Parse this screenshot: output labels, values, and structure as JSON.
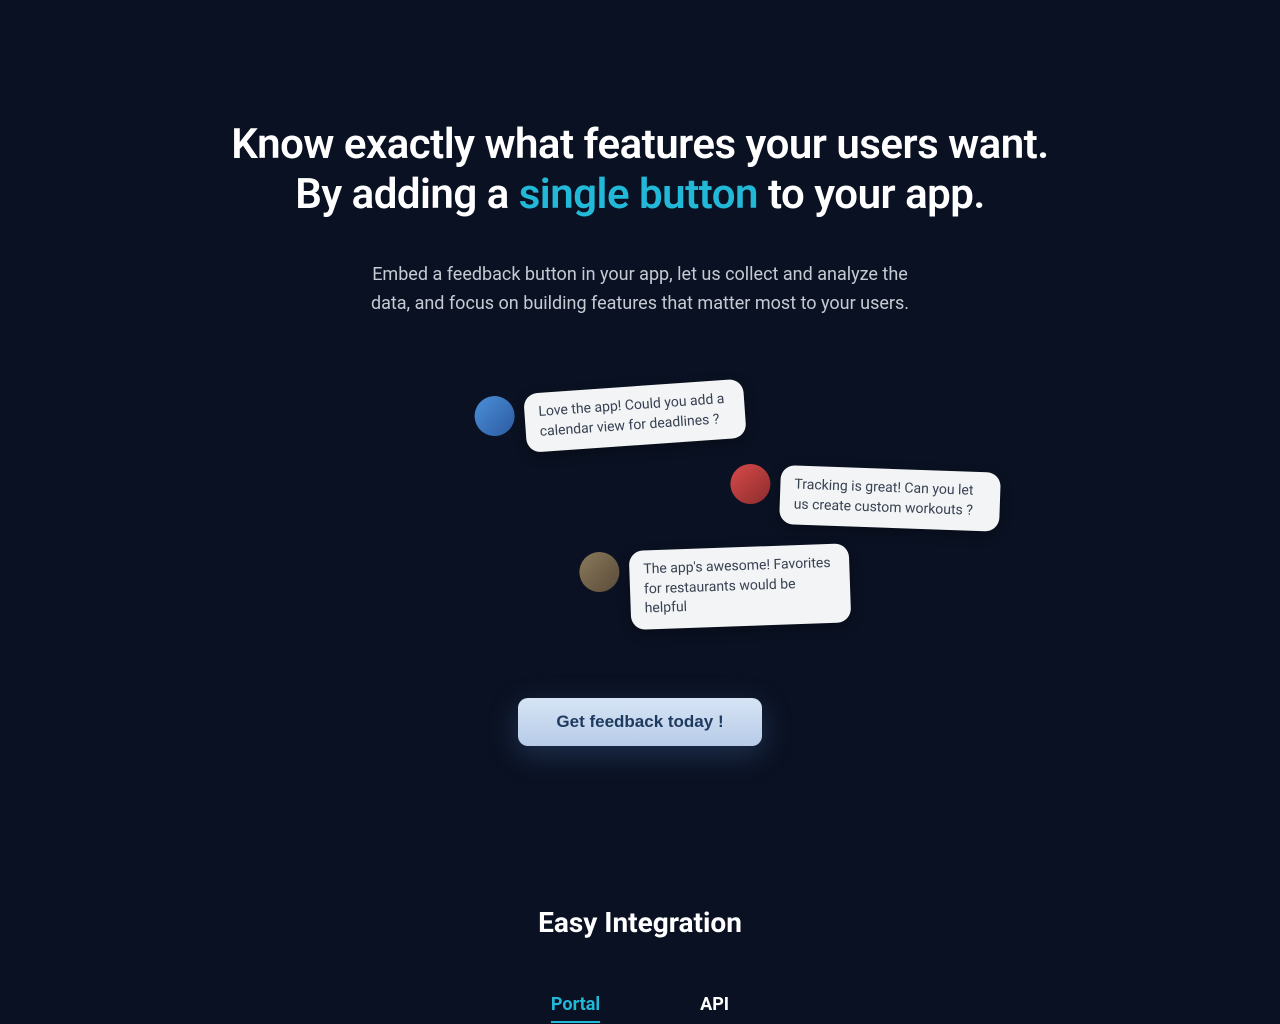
{
  "hero": {
    "title_line1": "Know exactly what features your users want.",
    "title_line2_pre": "By adding a ",
    "title_line2_highlight": "single button",
    "title_line2_post": " to your app.",
    "subtitle": "Embed a feedback button in your app, let us collect and analyze the data, and focus on building features that matter most to your users."
  },
  "messages": [
    {
      "text": "Love the app! Could you add a calendar view for deadlines ?"
    },
    {
      "text": "Tracking is great! Can you let us create custom workouts ?"
    },
    {
      "text": "The app's awesome! Favorites for restaurants would be helpful"
    }
  ],
  "cta": {
    "label": "Get feedback today !"
  },
  "integration": {
    "title": "Easy Integration",
    "tabs": [
      {
        "label": "Portal",
        "active": true
      },
      {
        "label": "API",
        "active": false
      }
    ]
  }
}
